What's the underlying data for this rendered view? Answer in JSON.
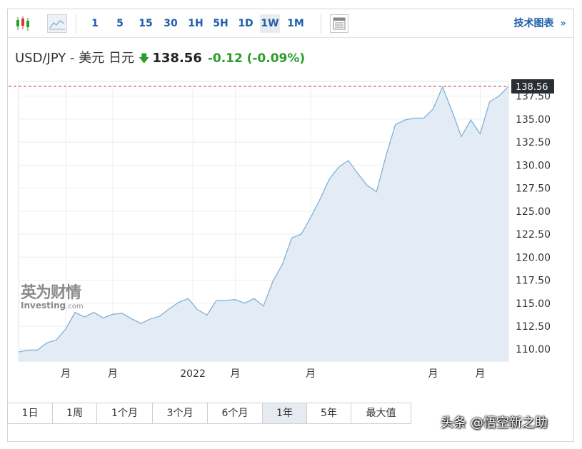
{
  "toolbar": {
    "timeframes": [
      "1",
      "5",
      "15",
      "30",
      "1H",
      "5H",
      "1D",
      "1W",
      "1M"
    ],
    "active_timeframe": "1W",
    "tech_chart_label": "技术图表",
    "tech_chart_arrow": "»"
  },
  "quote": {
    "pair": "USD/JPY - 美元 日元",
    "price": "138.56",
    "change": "-0.12",
    "change_pct": "(-0.09%)",
    "direction_color": "#2a9d2a"
  },
  "logo": {
    "cn": "英为财情",
    "en": "Investing",
    "suffix": ".com"
  },
  "periods": [
    "1日",
    "1周",
    "1个月",
    "3个月",
    "6个月",
    "1年",
    "5年",
    "最大值"
  ],
  "active_period": "1年",
  "watermark": "头条 @悟空新之助",
  "chart_data": {
    "type": "area",
    "title": "",
    "xlabel": "",
    "ylabel": "",
    "ylim": [
      108.7,
      139.1
    ],
    "yticks": [
      "110.00",
      "112.50",
      "115.00",
      "117.50",
      "120.00",
      "122.50",
      "125.00",
      "127.50",
      "130.00",
      "132.50",
      "135.00",
      "137.50"
    ],
    "ytick_values": [
      110,
      112.5,
      115,
      117.5,
      120,
      122.5,
      125,
      127.5,
      130,
      132.5,
      135,
      137.5
    ],
    "xtick_labels": [
      "月",
      "月",
      "2022",
      "月",
      "月",
      "月",
      "月"
    ],
    "xtick_index": [
      5.0,
      10.0,
      18.5,
      23.0,
      31.0,
      44.0,
      49.0
    ],
    "current_value_label": "138.56",
    "current_value": 138.56,
    "colors": {
      "line": "#7fb1d8",
      "fill": "#e3ecf5",
      "ref_line": "#c0392b",
      "badge": "#2a2f36"
    },
    "grid": true,
    "values": [
      109.7,
      109.9,
      109.9,
      110.7,
      111.0,
      112.2,
      114.0,
      113.5,
      114.0,
      113.4,
      113.8,
      113.9,
      113.3,
      112.8,
      113.3,
      113.6,
      114.4,
      115.1,
      115.5,
      114.3,
      113.7,
      115.3,
      115.3,
      115.4,
      115.0,
      115.5,
      114.7,
      117.4,
      119.2,
      122.1,
      122.5,
      124.3,
      126.3,
      128.5,
      129.8,
      130.5,
      129.1,
      127.8,
      127.1,
      131.0,
      134.4,
      134.9,
      135.1,
      135.1,
      136.1,
      138.5,
      135.9,
      133.1,
      134.9,
      133.4,
      136.9,
      137.5,
      138.56
    ]
  }
}
